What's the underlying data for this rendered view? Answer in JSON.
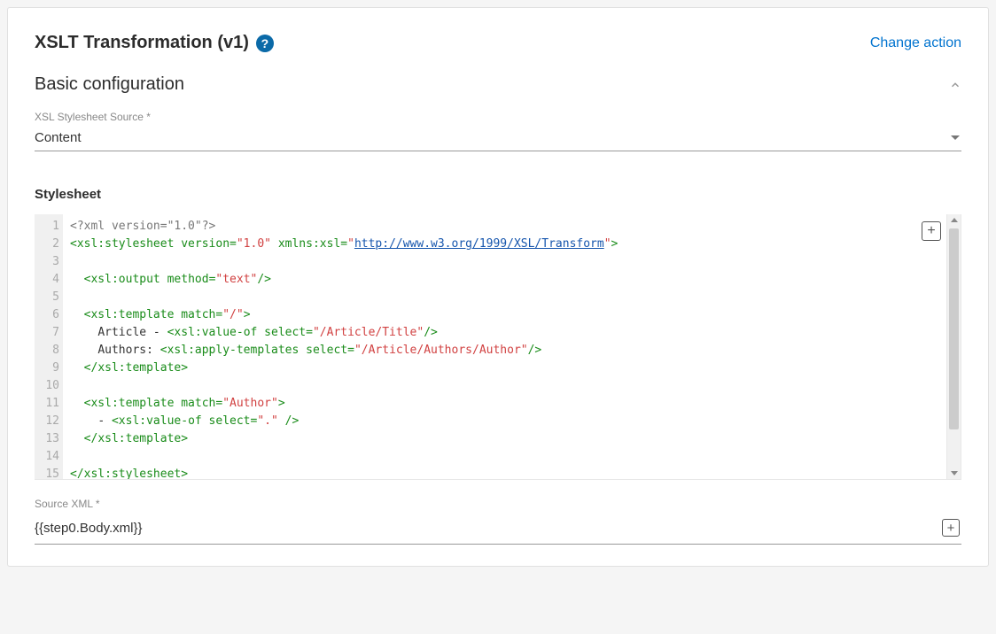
{
  "header": {
    "title": "XSLT Transformation (v1)",
    "help_icon": "?",
    "change_action": "Change action"
  },
  "section": {
    "title": "Basic configuration"
  },
  "xsl_source": {
    "label": "XSL Stylesheet Source *",
    "value": "Content"
  },
  "stylesheet": {
    "label": "Stylesheet",
    "line_numbers": [
      "1",
      "2",
      "3",
      "4",
      "5",
      "6",
      "7",
      "8",
      "9",
      "10",
      "11",
      "12",
      "13",
      "14",
      "15"
    ],
    "code": {
      "l1": {
        "pi": "<?xml version=\"1.0\"?>"
      },
      "l2": {
        "open": "<",
        "tag": "xsl:stylesheet",
        "a1": "version",
        "eq": "=",
        "v1": "\"1.0\"",
        "a2": "xmlns:xsl",
        "v2o": "\"",
        "url": "http://www.w3.org/1999/XSL/Transform",
        "v2c": "\"",
        "close": ">"
      },
      "l4": {
        "ind": "  ",
        "open": "<",
        "tag": "xsl:output",
        "a1": "method",
        "eq": "=",
        "v1": "\"text\"",
        "close": "/>"
      },
      "l6": {
        "ind": "  ",
        "open": "<",
        "tag": "xsl:template",
        "a1": "match",
        "eq": "=",
        "v1": "\"/\"",
        "close": ">"
      },
      "l7": {
        "ind": "    ",
        "txt": "Article - ",
        "open": "<",
        "tag": "xsl:value-of",
        "a1": "select",
        "eq": "=",
        "v1": "\"/Article/Title\"",
        "close": "/>"
      },
      "l8": {
        "ind": "    ",
        "txt": "Authors: ",
        "open": "<",
        "tag": "xsl:apply-templates",
        "a1": "select",
        "eq": "=",
        "v1": "\"/Article/Authors/Author\"",
        "close": "/>"
      },
      "l9": {
        "ind": "  ",
        "open": "</",
        "tag": "xsl:template",
        "close": ">"
      },
      "l11": {
        "ind": "  ",
        "open": "<",
        "tag": "xsl:template",
        "a1": "match",
        "eq": "=",
        "v1": "\"Author\"",
        "close": ">"
      },
      "l12": {
        "ind": "    ",
        "txt": "- ",
        "open": "<",
        "tag": "xsl:value-of",
        "a1": "select",
        "eq": "=",
        "v1": "\".\"",
        "sp": " ",
        "close": "/>"
      },
      "l13": {
        "ind": "  ",
        "open": "</",
        "tag": "xsl:template",
        "close": ">"
      },
      "l15": {
        "open": "</",
        "tag": "xsl:stylesheet",
        "close": ">"
      }
    }
  },
  "source_xml": {
    "label": "Source XML *",
    "value": "{{step0.Body.xml}}"
  },
  "glyphs": {
    "plus": "+"
  }
}
